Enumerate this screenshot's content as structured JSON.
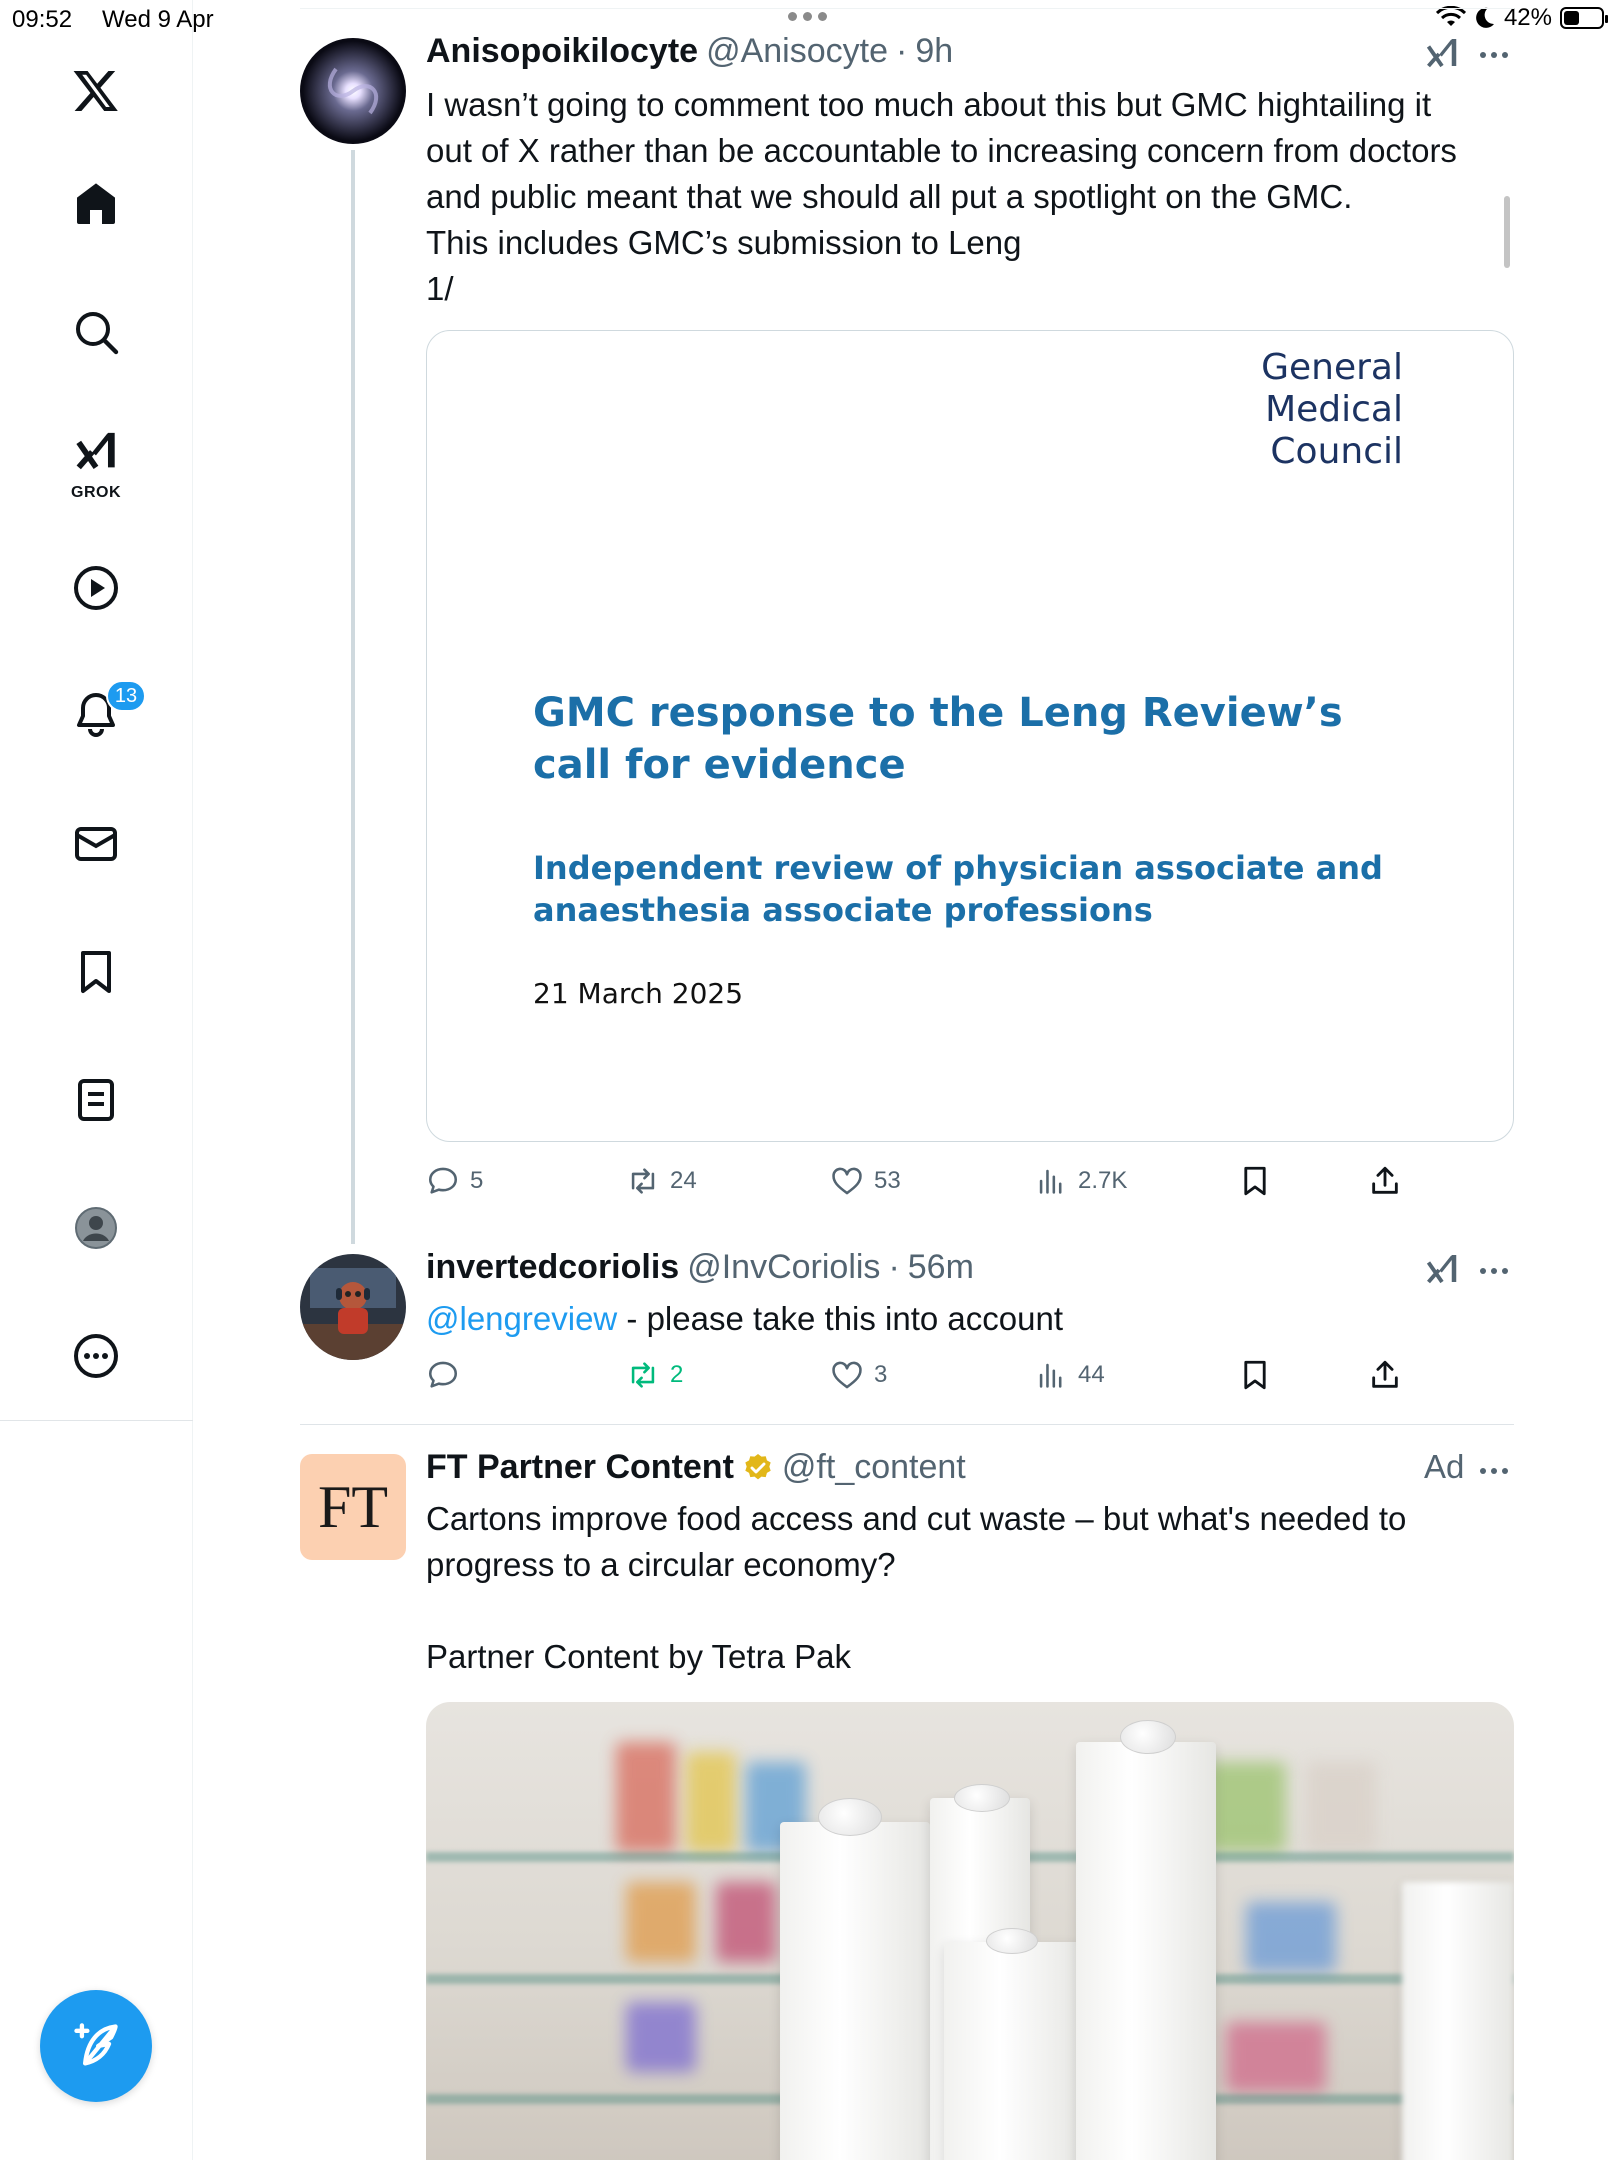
{
  "status_bar": {
    "time": "09:52",
    "date": "Wed 9 Apr",
    "battery": "42%",
    "battery_level": 0.42
  },
  "sidebar": {
    "notifications_badge": "13",
    "grok_label": "GROK"
  },
  "tweets": [
    {
      "name": "Anisopoikilocyte",
      "handle": "@Anisocyte",
      "sep": "·",
      "time": "9h",
      "text_lines": [
        "I wasn’t going to comment too much about this but GMC hightailing it",
        "out of X rather than be accountable to increasing concern from doctors",
        "and public meant that we should all put a spotlight on the GMC.",
        "This includes GMC’s submission to Leng",
        "1/"
      ],
      "card": {
        "logo_lines": [
          "General",
          "Medical",
          "Council"
        ],
        "title": "GMC response to the Leng Review’s call for evidence",
        "subtitle": "Independent review of physician associate and anaesthesia associate professions",
        "date": "21 March 2025"
      },
      "stats": {
        "replies": "5",
        "reposts": "24",
        "likes": "53",
        "views": "2.7K"
      }
    },
    {
      "name": "invertedcoriolis",
      "handle": "@InvCoriolis",
      "sep": "·",
      "time": "56m",
      "mention": "@lengreview",
      "text_rest": " - please take this into account",
      "stats": {
        "replies": "",
        "reposts": "2",
        "likes": "3",
        "views": "44"
      }
    },
    {
      "name": "FT Partner Content",
      "handle": "@ft_content",
      "avatar_text": "FT",
      "ad_label": "Ad",
      "text_lines": [
        "Cartons improve food access and cut waste – but what's needed to",
        "progress to a circular economy?",
        "",
        "Partner Content by Tetra Pak"
      ]
    }
  ],
  "colors": {
    "accent": "#1d9bf0",
    "repost_active": "#00ba7c",
    "secondary_text": "#536471",
    "gmc_blue": "#1b6fa8",
    "ft_pink": "#fcd0b1"
  }
}
